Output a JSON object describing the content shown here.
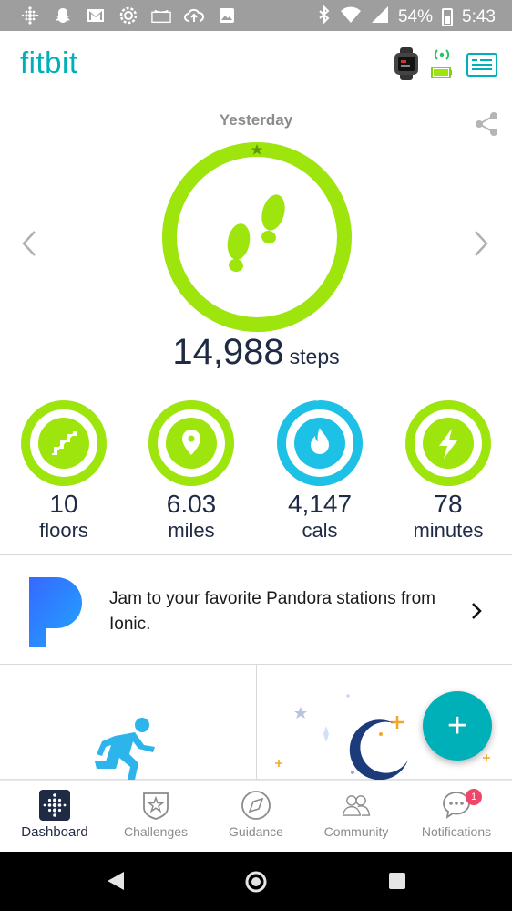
{
  "status_bar": {
    "battery_percent": "54%",
    "time": "5:43",
    "icons_left": [
      "fitbit-dots-icon",
      "snapchat-icon",
      "gmail-icon",
      "settings-icon",
      "amazon-icon",
      "cloud-upload-icon",
      "image-icon"
    ],
    "icons_right": [
      "bluetooth-icon",
      "wifi-icon",
      "signal-icon",
      "battery-icon"
    ]
  },
  "header": {
    "logo": "fitbit",
    "accent_color": "#00b0b9"
  },
  "hero": {
    "day_label": "Yesterday",
    "steps_value": "14,988",
    "steps_unit": "steps",
    "steps_progress": 1.0,
    "ring_color": "#9ee50e"
  },
  "metrics": [
    {
      "value": "10",
      "label": "floors",
      "icon": "stairs-icon",
      "progress": 1.0,
      "color": "#9ee50e"
    },
    {
      "value": "6.03",
      "label": "miles",
      "icon": "location-pin-icon",
      "progress": 1.0,
      "color": "#9ee50e"
    },
    {
      "value": "4,147",
      "label": "cals",
      "icon": "flame-icon",
      "progress": 0.98,
      "color": "#1ec1e6"
    },
    {
      "value": "78",
      "label": "minutes",
      "icon": "lightning-icon",
      "progress": 1.0,
      "color": "#9ee50e"
    }
  ],
  "pandora_card": {
    "text": "Jam to your favorite Pandora stations from Ionic."
  },
  "fab": {
    "label": "+"
  },
  "bottom_nav": [
    {
      "label": "Dashboard",
      "icon": "dashboard-icon",
      "active": true
    },
    {
      "label": "Challenges",
      "icon": "challenges-star-icon",
      "active": false
    },
    {
      "label": "Guidance",
      "icon": "compass-icon",
      "active": false
    },
    {
      "label": "Community",
      "icon": "community-people-icon",
      "active": false
    },
    {
      "label": "Notifications",
      "icon": "chat-bubble-icon",
      "active": false,
      "badge": "1"
    }
  ]
}
